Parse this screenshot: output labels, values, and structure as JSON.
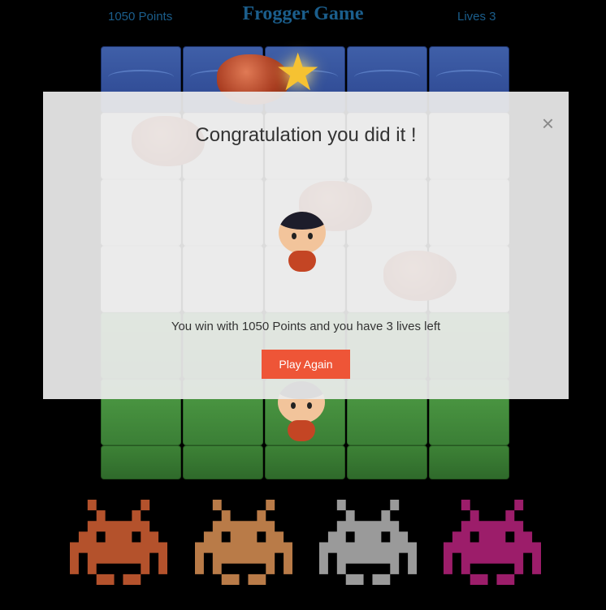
{
  "hud": {
    "points": "1050 Points",
    "title": "Frogger Game",
    "lives": "Lives 3"
  },
  "modal": {
    "heading": "Congratulation you did it !",
    "message": "You win with 1050 Points and you have 3 lives left",
    "play_again_label": "Play Again",
    "close_glyph": "×"
  },
  "board": {
    "columns": 5,
    "rows": [
      "water",
      "stone",
      "stone",
      "stone",
      "grass",
      "grass",
      "grass"
    ],
    "icons": [
      "star-icon",
      "ladybug-enemy-icon",
      "player-character-icon"
    ]
  },
  "invaders": {
    "colors": [
      "#b4522c",
      "#b97b48",
      "#9a9a9a",
      "#9c1d6a"
    ],
    "icon": "space-invader-icon"
  }
}
